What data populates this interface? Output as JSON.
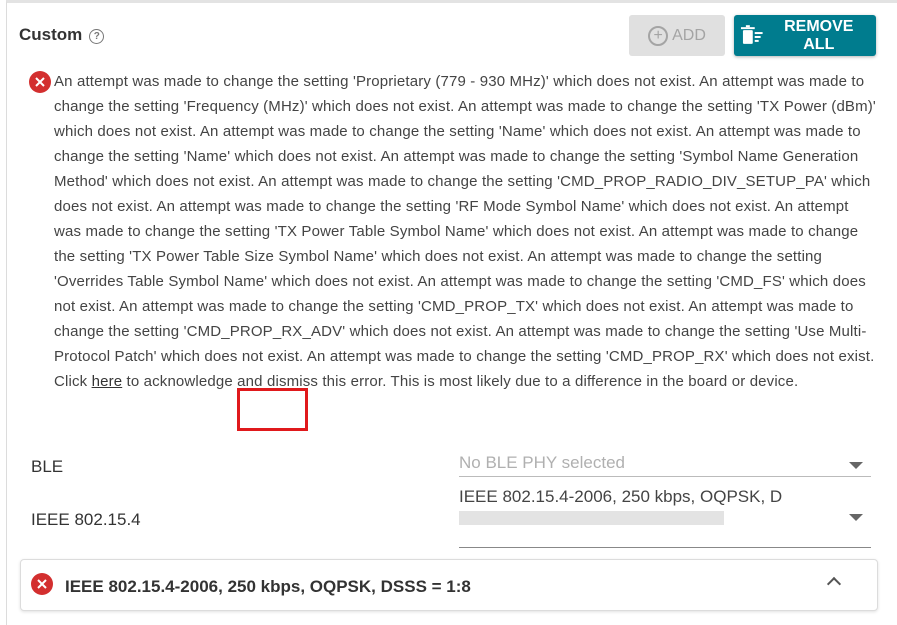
{
  "header": {
    "title": "Custom",
    "help_icon": "?"
  },
  "toolbar": {
    "add_label": "ADD",
    "remove_all_label": "REMOVE ALL"
  },
  "error": {
    "text_before_link": "An attempt was made to change the setting 'Proprietary (779 - 930 MHz)' which does not exist. An attempt was made to change the setting 'Frequency (MHz)' which does not exist. An attempt was made to change the setting 'TX Power (dBm)' which does not exist. An attempt was made to change the setting 'Name' which does not exist. An attempt was made to change the setting 'Name' which does not exist. An attempt was made to change the setting 'Symbol Name Generation Method' which does not exist. An attempt was made to change the setting 'CMD_PROP_RADIO_DIV_SETUP_PA' which does not exist. An attempt was made to change the setting 'RF Mode Symbol Name' which does not exist. An attempt was made to change the setting 'TX Power Table Symbol Name' which does not exist. An attempt was made to change the setting 'TX Power Table Size Symbol Name' which does not exist. An attempt was made to change the setting 'Overrides Table Symbol Name' which does not exist. An attempt was made to change the setting 'CMD_FS' which does not exist. An attempt was made to change the setting 'CMD_PROP_TX' which does not exist. An attempt was made to change the setting 'CMD_PROP_RX_ADV' which does not exist. An attempt was made to change the setting 'Use Multi-Protocol Patch' which does not exist. An attempt was made to change the setting 'CMD_PROP_RX' which does not exist. Click ",
    "link_text": "here",
    "text_after_link": " to acknowledge and dismiss this error. This is most likely due to a difference in the board or device."
  },
  "fields": {
    "ble_label": "BLE",
    "ble_placeholder": "No BLE PHY selected",
    "ieee_label": "IEEE 802.15.4",
    "ieee_value": "IEEE 802.15.4-2006, 250 kbps, OQPSK, D"
  },
  "accordion": {
    "title": "IEEE 802.15.4-2006, 250 kbps, OQPSK, DSSS = 1:8"
  },
  "colors": {
    "accent": "#007c8e",
    "error": "#d32f2f",
    "highlight": "#e0191c",
    "disabled_bg": "#e0e0e0"
  }
}
